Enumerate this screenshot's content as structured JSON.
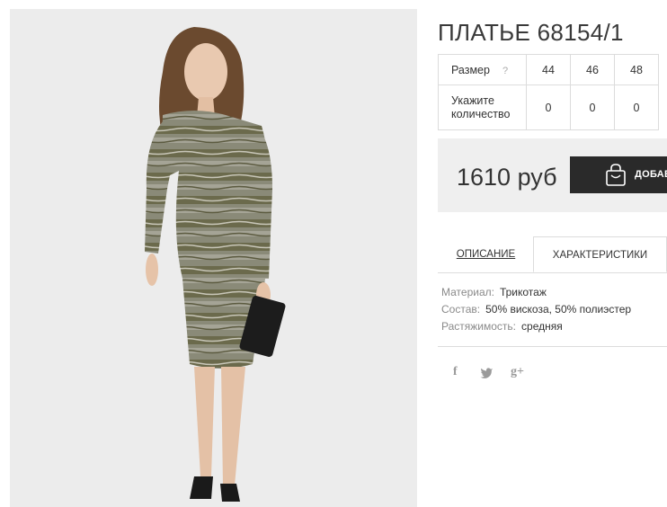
{
  "product": {
    "title": "ПЛАТЬЕ 68154/1",
    "image_alt": "dress model photo"
  },
  "size_table": {
    "size_label": "Размер",
    "help_icon": "?",
    "sizes": [
      "44",
      "46",
      "48"
    ],
    "qty_label": "Укажите количество",
    "quantities": [
      "0",
      "0",
      "0"
    ]
  },
  "purchase": {
    "price": "1610 руб",
    "add_button_label": "ДОБАВ",
    "cart_icon": "shopping-bag-icon"
  },
  "tabs": [
    {
      "label": "ОПИСАНИЕ",
      "active": false
    },
    {
      "label": "ХАРАКТЕРИСТИКИ",
      "active": true
    }
  ],
  "characteristics": [
    {
      "key": "Материал:",
      "value": "Трикотаж"
    },
    {
      "key": "Состав:",
      "value": "50% вискоза, 50% полиэстер"
    },
    {
      "key": "Растяжимость:",
      "value": "средняя"
    }
  ],
  "social": {
    "facebook": "f",
    "twitter": "t",
    "google": "g+"
  },
  "colors": {
    "accent_button": "#2a2a2a",
    "price_bg": "#efefef",
    "photo_bg": "#ececec"
  }
}
